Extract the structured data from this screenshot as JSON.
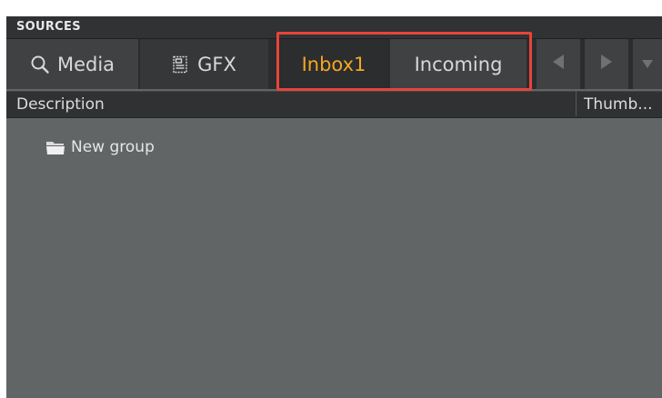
{
  "panel": {
    "title": "SOURCES"
  },
  "tabs": [
    {
      "label": "Media",
      "icon": "search-icon",
      "active": false
    },
    {
      "label": "GFX",
      "icon": "gfx-icon",
      "active": false
    },
    {
      "label": "Inbox1",
      "icon": null,
      "active": true
    },
    {
      "label": "Incoming",
      "icon": null,
      "active": false
    }
  ],
  "nav": {
    "prev_icon": "triangle-left-icon",
    "next_icon": "triangle-right-icon",
    "menu_icon": "triangle-down-icon"
  },
  "columns": {
    "description": "Description",
    "thumbnail": "Thumb..."
  },
  "items": [
    {
      "label": "New group",
      "icon": "folder-icon"
    }
  ],
  "colors": {
    "active_tab_text": "#f5a623",
    "highlight_border": "#e8443a",
    "panel_bg": "#626566"
  }
}
